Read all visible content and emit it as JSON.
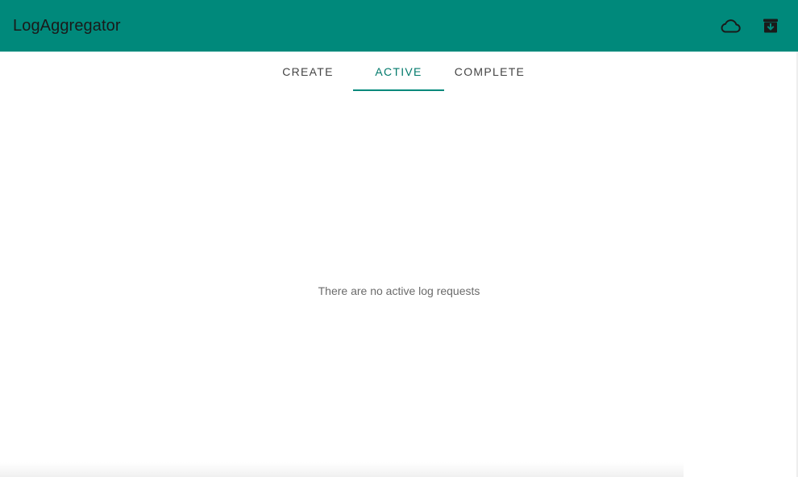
{
  "app_bar": {
    "title": "LogAggregator",
    "actions": [
      {
        "icon": "cloud-outline-icon"
      },
      {
        "icon": "archive-icon"
      }
    ],
    "color": "#00897B"
  },
  "tabs": [
    {
      "label": "CREATE",
      "selected": false
    },
    {
      "label": "ACTIVE",
      "selected": true
    },
    {
      "label": "COMPLETE",
      "selected": false
    }
  ],
  "main": {
    "empty_message": "There are no active log requests"
  },
  "colors": {
    "accent": "#00897B",
    "active_tab_text": "#00796B"
  }
}
